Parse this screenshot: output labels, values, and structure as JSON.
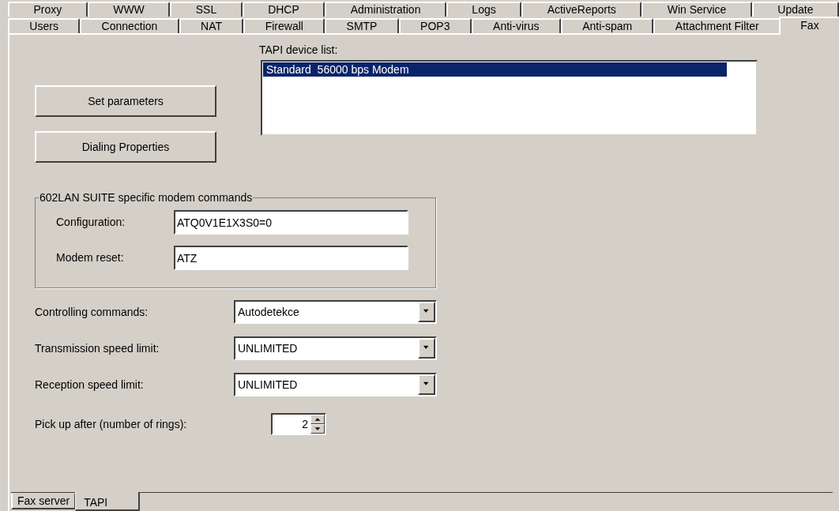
{
  "tabs_row_1": [
    {
      "label": "Proxy",
      "selected": false
    },
    {
      "label": "WWW",
      "selected": false
    },
    {
      "label": "SSL",
      "selected": false
    },
    {
      "label": "DHCP",
      "selected": false
    },
    {
      "label": "Administration",
      "selected": false
    },
    {
      "label": "Logs",
      "selected": false
    },
    {
      "label": "ActiveReports",
      "selected": false
    },
    {
      "label": "Win Service",
      "selected": false
    },
    {
      "label": "Update",
      "selected": false
    }
  ],
  "tabs_row_2": [
    {
      "label": "Users",
      "selected": false
    },
    {
      "label": "Connection",
      "selected": false
    },
    {
      "label": "NAT",
      "selected": false
    },
    {
      "label": "Firewall",
      "selected": false
    },
    {
      "label": "SMTP",
      "selected": false
    },
    {
      "label": "POP3",
      "selected": false
    },
    {
      "label": "Anti-virus",
      "selected": false
    },
    {
      "label": "Anti-spam",
      "selected": false
    },
    {
      "label": "Attachment Filter",
      "selected": false
    },
    {
      "label": "Fax",
      "selected": true
    }
  ],
  "buttons": [
    "Set parameters",
    "Dialing Properties"
  ],
  "device_list": {
    "label": "TAPI device list:",
    "items": [
      {
        "label": "Standard  56000 bps Modem",
        "selected": true
      }
    ]
  },
  "modem_commands": {
    "title": "602LAN SUITE specific modem commands",
    "fields": [
      {
        "label": "Configuration:",
        "value": "ATQ0V1E1X3S0=0"
      },
      {
        "label": "Modem reset:",
        "value": "ATZ"
      }
    ]
  },
  "dropdowns": [
    {
      "label": "Controlling commands:",
      "value": "Autodetekce"
    },
    {
      "label": "Transmission speed limit:",
      "value": "UNLIMITED"
    },
    {
      "label": "Reception speed limit:",
      "value": "UNLIMITED"
    }
  ],
  "spinner": {
    "label": "Pick up after (number of rings):",
    "value": "2"
  },
  "bottom_tabs": [
    {
      "label": "Fax server",
      "selected": false
    },
    {
      "label": "TAPI",
      "selected": true
    }
  ]
}
